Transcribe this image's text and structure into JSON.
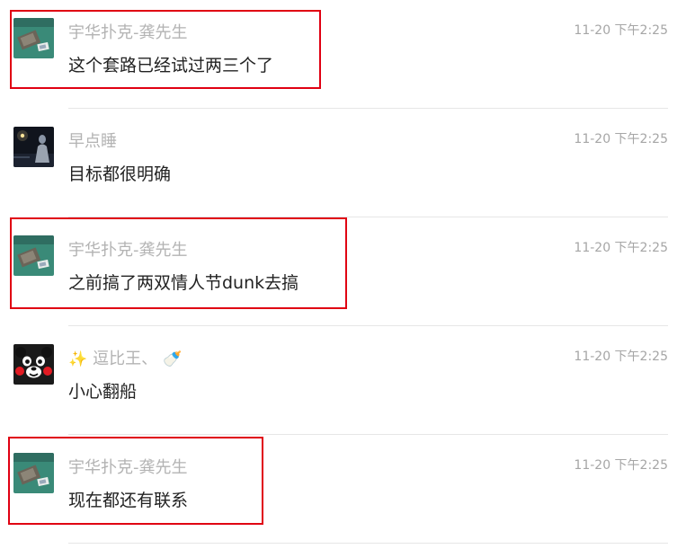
{
  "colors": {
    "highlight": "#e00012",
    "sender_text": "#b3b3b3",
    "message_text": "#222222",
    "time_text": "#a6a6a6"
  },
  "messages": [
    {
      "avatar": "green-mat-with-card-avatar",
      "sender": "宇华扑克-龚先生",
      "text": "这个套路已经试过两三个了",
      "time": "11-20 下午2:25",
      "highlighted": true
    },
    {
      "avatar": "night-figure-avatar",
      "sender": "早点睡",
      "text": "目标都很明确",
      "time": "11-20 下午2:25",
      "highlighted": false
    },
    {
      "avatar": "green-mat-with-card-avatar",
      "sender": "宇华扑克-龚先生",
      "text": "之前搞了两双情人节dunk去搞",
      "time": "11-20 下午2:25",
      "highlighted": true
    },
    {
      "avatar": "kumamon-bear-avatar",
      "sender_prefix_emoji": "✨",
      "sender": "逗比王、",
      "sender_suffix_emoji": "🍼",
      "text": "小心翻船",
      "time": "11-20 下午2:25",
      "highlighted": false
    },
    {
      "avatar": "green-mat-with-card-avatar",
      "sender": "宇华扑克-龚先生",
      "text": "现在都还有联系",
      "time": "11-20 下午2:25",
      "highlighted": true
    }
  ]
}
